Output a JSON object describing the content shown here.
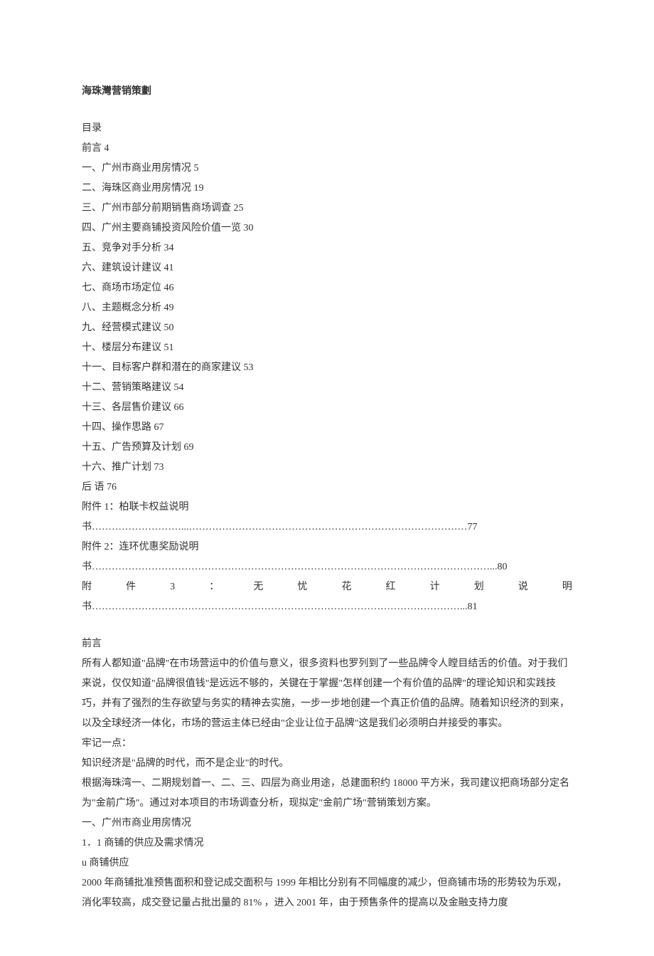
{
  "title": "海珠灣营销策劃",
  "toc_header": "目录",
  "toc": [
    "前言 4",
    "一、广州市商业用房情况 5",
    "二、海珠区商业用房情况 19",
    "三、广州市部分前期销售商场调查 25",
    "四、广州主要商铺投资风险价值一览 30",
    "五、竞争对手分析 34",
    "六、建筑设计建议 41",
    "七、商场市场定位 46",
    "八、主题概念分析 49",
    "九、经营模式建议 50",
    "十、楼层分布建议 51",
    "十一、目标客户群和潜在的商家建议 53",
    "十二、营销策略建议 54",
    "十三、各层售价建议 66",
    "十四、操作思路 67",
    "十五、广告预算及计划 69",
    "十六、推广计划 73",
    "后 语 76"
  ],
  "appendix": [
    "附件 1：柏联卡权益说明书………………………...…………………………………………………………………………77",
    "附件 2：连环优惠奖励说明书…………………………………………………………………………………………………………...80"
  ],
  "appendix3_chars": [
    "附",
    "件",
    "3",
    "：",
    "无",
    "忧",
    "花",
    "红",
    "计",
    "划",
    "说",
    "明"
  ],
  "appendix3_line2": "书…………………………………………………………………………………………………...81",
  "preface": {
    "heading": "前言",
    "paragraphs": [
      "所有人都知道\"品牌\"在市场营运中的价值与意义，很多资料也罗列到了一些品牌令人瞠目结舌的价值。对于我们来说，仅仅知道\"品牌很值钱\"是远远不够的，关键在于掌握\"怎样创建一个有价值的品牌\"的理论知识和实践技巧，并有了强烈的生存欲望与务实的精神去实施，一步一步地创建一个真正价值的品牌。随着知识经济的到来，以及全球经济一体化，市场的营运主体已经由\"企业让位于品牌\"这是我们必须明白并接受的事实。",
      "牢记一点：",
      "知识经济是\"品牌的时代，而不是企业\"的时代。",
      "根据海珠湾一、二期规划首一、二、三、四层为商业用途，总建面积约 18000 平方米，我司建议把商场部分定名为\"金前广场\"。通过对本项目的市场调查分析，现拟定\"金前广场\"营销策划方案。"
    ]
  },
  "section1": {
    "heading": "一、广州市商业用房情况",
    "sub": "1．1 商铺的供应及需求情况",
    "bullet": "u 商铺供应",
    "para": "2000 年商铺批准预售面积和登记成交面积与 1999 年相比分别有不同幅度的减少，但商铺市场的形势较为乐观，消化率较高，成交登记量占批出量的 81% ，进入 2001 年，由于预售条件的提高以及金融支持力度"
  }
}
